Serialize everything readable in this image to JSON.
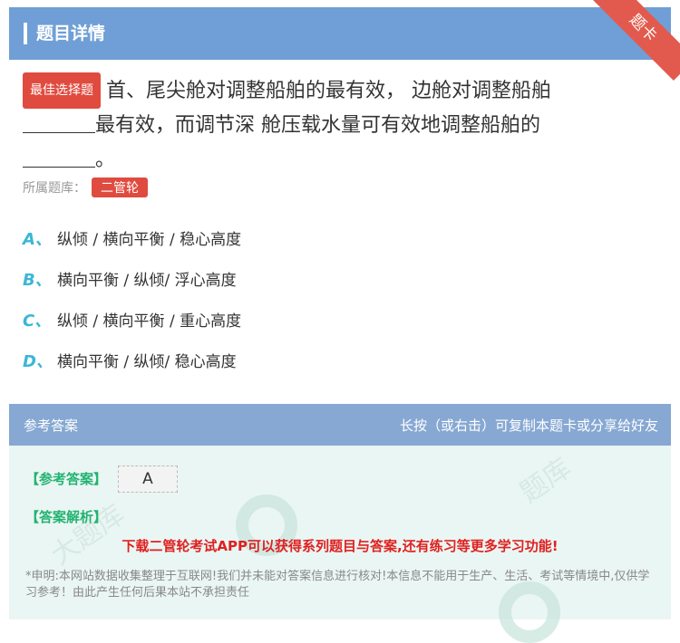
{
  "header": {
    "title": "题目详情",
    "ribbon": "题卡"
  },
  "question": {
    "type_tag": "最佳选择题",
    "text_part1": "首、尾尖舱对调整船舶的最有效， 边舱对调整船舶",
    "text_part2": "最有效，而调节深 舱压载水量可有效地调整船舶的",
    "text_end": "。",
    "bank_label": "所属题库：",
    "bank_tag": "二管轮"
  },
  "options": [
    {
      "letter": "A、",
      "text": "纵倾 / 横向平衡 / 稳心高度"
    },
    {
      "letter": "B、",
      "text": "横向平衡 / 纵倾/ 浮心高度"
    },
    {
      "letter": "C、",
      "text": "纵倾 / 横向平衡 / 重心高度"
    },
    {
      "letter": "D、",
      "text": "横向平衡 / 纵倾/ 稳心高度"
    }
  ],
  "answer": {
    "head_left": "参考答案",
    "head_right": "长按（或右击）可复制本题卡或分享给好友",
    "ref_label": "【参考答案】",
    "ref_value": "A",
    "analysis_label": "【答案解析】",
    "promo": "下载二管轮考试APP可以获得系列题目与答案,还有练习等更多学习功能!",
    "disclaimer": "*申明:本网站数据收集整理于互联网!我们并未能对答案信息进行核对!本信息不能用于生产、生活、考试等情境中,仅供学习参考！由此产生任何后果本站不承担责任"
  },
  "colors": {
    "header_bg": "#6f9fd6",
    "accent_red": "#e04b3f",
    "option_letter": "#3ab7d6",
    "answer_green": "#23b372"
  }
}
